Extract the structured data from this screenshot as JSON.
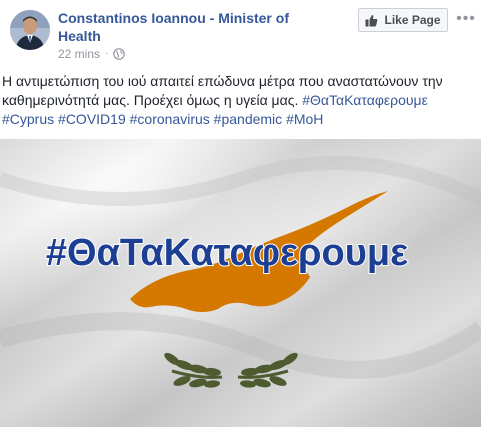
{
  "post": {
    "author": "Constantinos Ioannou - Minister of Health",
    "timestamp": "22 mins",
    "separator": "·",
    "privacy_icon": "globe-icon",
    "like_page_label": "Like Page",
    "more_label": "•••",
    "text": "Η αντιμετώπιση του ιού απαιτεί επώδυνα μέτρα που αναστατώνουν την καθημερινότητά μας. Προέχει όμως η υγεία μας.",
    "hashtags": [
      "#ΘαΤαΚαταφερουμε",
      "#Cyprus",
      "#COVID19",
      "#coronavirus",
      "#pandemic",
      "#MoH"
    ]
  },
  "image": {
    "slogan": "#ΘαΤαΚαταφερουμε",
    "colors": {
      "slogan": "#1c3f94",
      "map": "#d57800",
      "olive": "#4e5b31",
      "flag": "#eeeeee"
    }
  },
  "colors": {
    "link": "#365899",
    "text": "#1d2129",
    "meta": "#90949c"
  }
}
